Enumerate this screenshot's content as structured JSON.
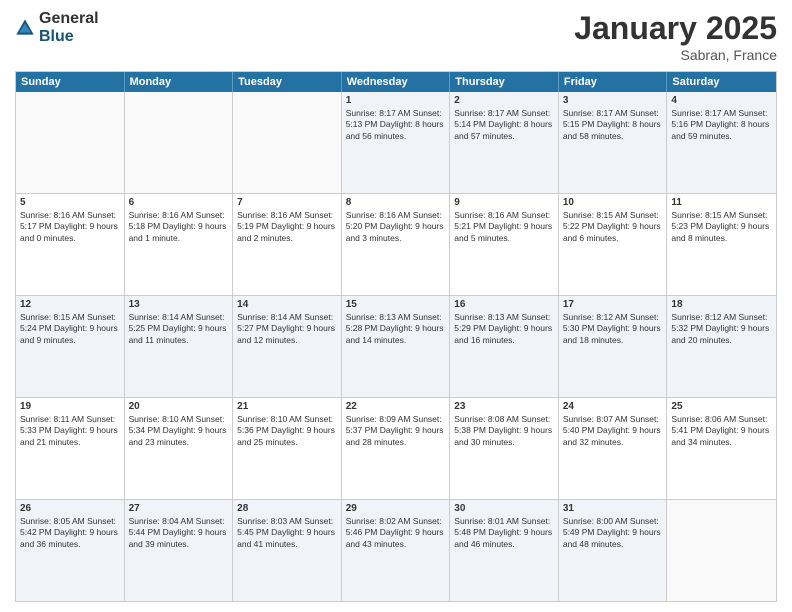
{
  "logo": {
    "general": "General",
    "blue": "Blue"
  },
  "title": "January 2025",
  "location": "Sabran, France",
  "days_of_week": [
    "Sunday",
    "Monday",
    "Tuesday",
    "Wednesday",
    "Thursday",
    "Friday",
    "Saturday"
  ],
  "weeks": [
    [
      {
        "day": "",
        "text": ""
      },
      {
        "day": "",
        "text": ""
      },
      {
        "day": "",
        "text": ""
      },
      {
        "day": "1",
        "text": "Sunrise: 8:17 AM\nSunset: 5:13 PM\nDaylight: 8 hours\nand 56 minutes."
      },
      {
        "day": "2",
        "text": "Sunrise: 8:17 AM\nSunset: 5:14 PM\nDaylight: 8 hours\nand 57 minutes."
      },
      {
        "day": "3",
        "text": "Sunrise: 8:17 AM\nSunset: 5:15 PM\nDaylight: 8 hours\nand 58 minutes."
      },
      {
        "day": "4",
        "text": "Sunrise: 8:17 AM\nSunset: 5:16 PM\nDaylight: 8 hours\nand 59 minutes."
      }
    ],
    [
      {
        "day": "5",
        "text": "Sunrise: 8:16 AM\nSunset: 5:17 PM\nDaylight: 9 hours\nand 0 minutes."
      },
      {
        "day": "6",
        "text": "Sunrise: 8:16 AM\nSunset: 5:18 PM\nDaylight: 9 hours\nand 1 minute."
      },
      {
        "day": "7",
        "text": "Sunrise: 8:16 AM\nSunset: 5:19 PM\nDaylight: 9 hours\nand 2 minutes."
      },
      {
        "day": "8",
        "text": "Sunrise: 8:16 AM\nSunset: 5:20 PM\nDaylight: 9 hours\nand 3 minutes."
      },
      {
        "day": "9",
        "text": "Sunrise: 8:16 AM\nSunset: 5:21 PM\nDaylight: 9 hours\nand 5 minutes."
      },
      {
        "day": "10",
        "text": "Sunrise: 8:15 AM\nSunset: 5:22 PM\nDaylight: 9 hours\nand 6 minutes."
      },
      {
        "day": "11",
        "text": "Sunrise: 8:15 AM\nSunset: 5:23 PM\nDaylight: 9 hours\nand 8 minutes."
      }
    ],
    [
      {
        "day": "12",
        "text": "Sunrise: 8:15 AM\nSunset: 5:24 PM\nDaylight: 9 hours\nand 9 minutes."
      },
      {
        "day": "13",
        "text": "Sunrise: 8:14 AM\nSunset: 5:25 PM\nDaylight: 9 hours\nand 11 minutes."
      },
      {
        "day": "14",
        "text": "Sunrise: 8:14 AM\nSunset: 5:27 PM\nDaylight: 9 hours\nand 12 minutes."
      },
      {
        "day": "15",
        "text": "Sunrise: 8:13 AM\nSunset: 5:28 PM\nDaylight: 9 hours\nand 14 minutes."
      },
      {
        "day": "16",
        "text": "Sunrise: 8:13 AM\nSunset: 5:29 PM\nDaylight: 9 hours\nand 16 minutes."
      },
      {
        "day": "17",
        "text": "Sunrise: 8:12 AM\nSunset: 5:30 PM\nDaylight: 9 hours\nand 18 minutes."
      },
      {
        "day": "18",
        "text": "Sunrise: 8:12 AM\nSunset: 5:32 PM\nDaylight: 9 hours\nand 20 minutes."
      }
    ],
    [
      {
        "day": "19",
        "text": "Sunrise: 8:11 AM\nSunset: 5:33 PM\nDaylight: 9 hours\nand 21 minutes."
      },
      {
        "day": "20",
        "text": "Sunrise: 8:10 AM\nSunset: 5:34 PM\nDaylight: 9 hours\nand 23 minutes."
      },
      {
        "day": "21",
        "text": "Sunrise: 8:10 AM\nSunset: 5:36 PM\nDaylight: 9 hours\nand 25 minutes."
      },
      {
        "day": "22",
        "text": "Sunrise: 8:09 AM\nSunset: 5:37 PM\nDaylight: 9 hours\nand 28 minutes."
      },
      {
        "day": "23",
        "text": "Sunrise: 8:08 AM\nSunset: 5:38 PM\nDaylight: 9 hours\nand 30 minutes."
      },
      {
        "day": "24",
        "text": "Sunrise: 8:07 AM\nSunset: 5:40 PM\nDaylight: 9 hours\nand 32 minutes."
      },
      {
        "day": "25",
        "text": "Sunrise: 8:06 AM\nSunset: 5:41 PM\nDaylight: 9 hours\nand 34 minutes."
      }
    ],
    [
      {
        "day": "26",
        "text": "Sunrise: 8:05 AM\nSunset: 5:42 PM\nDaylight: 9 hours\nand 36 minutes."
      },
      {
        "day": "27",
        "text": "Sunrise: 8:04 AM\nSunset: 5:44 PM\nDaylight: 9 hours\nand 39 minutes."
      },
      {
        "day": "28",
        "text": "Sunrise: 8:03 AM\nSunset: 5:45 PM\nDaylight: 9 hours\nand 41 minutes."
      },
      {
        "day": "29",
        "text": "Sunrise: 8:02 AM\nSunset: 5:46 PM\nDaylight: 9 hours\nand 43 minutes."
      },
      {
        "day": "30",
        "text": "Sunrise: 8:01 AM\nSunset: 5:48 PM\nDaylight: 9 hours\nand 46 minutes."
      },
      {
        "day": "31",
        "text": "Sunrise: 8:00 AM\nSunset: 5:49 PM\nDaylight: 9 hours\nand 48 minutes."
      },
      {
        "day": "",
        "text": ""
      }
    ]
  ]
}
